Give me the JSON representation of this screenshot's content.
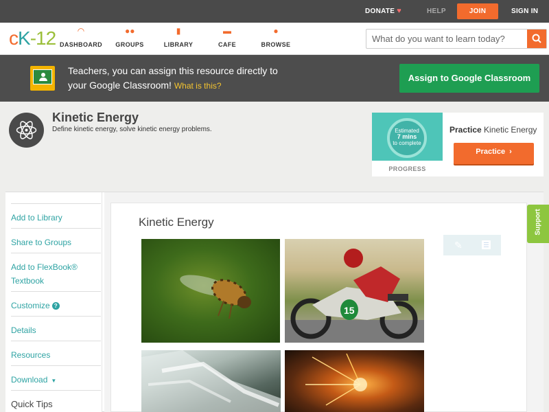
{
  "topbar": {
    "donate": "DONATE",
    "help": "HELP",
    "join": "JOIN",
    "signin": "SIGN IN"
  },
  "logo": {
    "c": "c",
    "k": "K",
    "dash": "-",
    "num": "12"
  },
  "nav": {
    "dashboard": "DASHBOARD",
    "groups": "GROUPS",
    "library": "LIBRARY",
    "cafe": "CAFE",
    "browse": "BROWSE"
  },
  "search": {
    "placeholder": "What do you want to learn today?"
  },
  "banner": {
    "text_line1": "Teachers, you can assign this resource directly to",
    "text_line2": "your Google Classroom!",
    "link": "What is this?",
    "assign_button": "Assign to Google Classroom"
  },
  "header": {
    "title": "Kinetic Energy",
    "subtitle": "Define kinetic energy, solve kinetic energy problems."
  },
  "practice": {
    "estimated_line1": "Estimated",
    "estimated_line2": "7 mins",
    "estimated_line3": "to complete",
    "progress_label": "PROGRESS",
    "title_bold": "Practice",
    "title_rest": "Kinetic Energy",
    "button": "Practice"
  },
  "sidebar": {
    "add_library": "Add to Library",
    "share_groups": "Share to Groups",
    "flexbook_line1": "Add to FlexBook®",
    "flexbook_line2": "Textbook",
    "customize": "Customize",
    "details": "Details",
    "resources": "Resources",
    "download": "Download",
    "quick_tips": "Quick Tips"
  },
  "content": {
    "title": "Kinetic Energy"
  },
  "support": "Support",
  "images": [
    "bee-in-flight",
    "motorcycle-racer",
    "water-cascade",
    "grinding-sparks"
  ],
  "colors": {
    "brand_orange": "#f26b2d",
    "brand_teal": "#2ea3a3",
    "assign_green": "#1e9e52",
    "support_green": "#8dc63f"
  }
}
